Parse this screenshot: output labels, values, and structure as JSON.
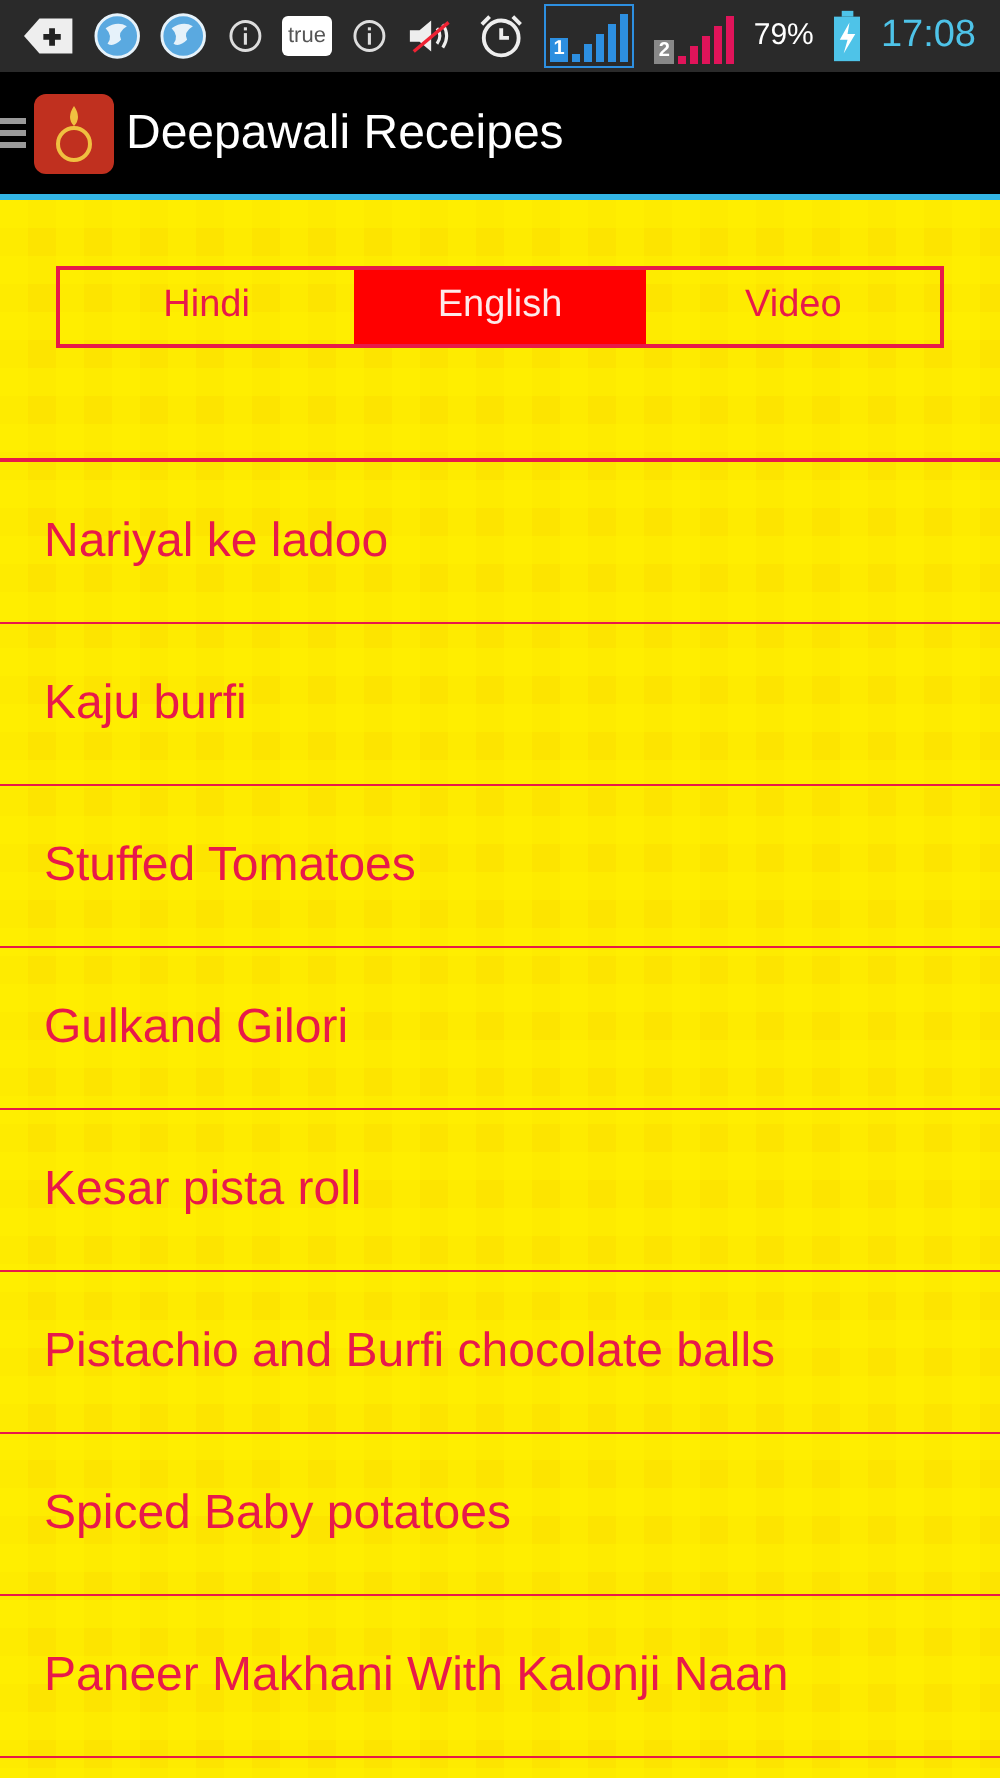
{
  "status_bar": {
    "notification_text": "true",
    "sim1": "1",
    "sim2": "2",
    "battery": "79%",
    "time": "17:08"
  },
  "app_bar": {
    "title": "Deepawali Receipes"
  },
  "tabs": [
    {
      "label": "Hindi",
      "selected": false
    },
    {
      "label": "English",
      "selected": true
    },
    {
      "label": "Video",
      "selected": false
    }
  ],
  "recipes": [
    "Nariyal ke ladoo",
    "Kaju burfi",
    "Stuffed Tomatoes",
    "Gulkand Gilori",
    "Kesar pista roll",
    "Pistachio and Burfi chocolate balls",
    "Spiced Baby potatoes",
    "Paneer Makhani With Kalonji Naan"
  ]
}
